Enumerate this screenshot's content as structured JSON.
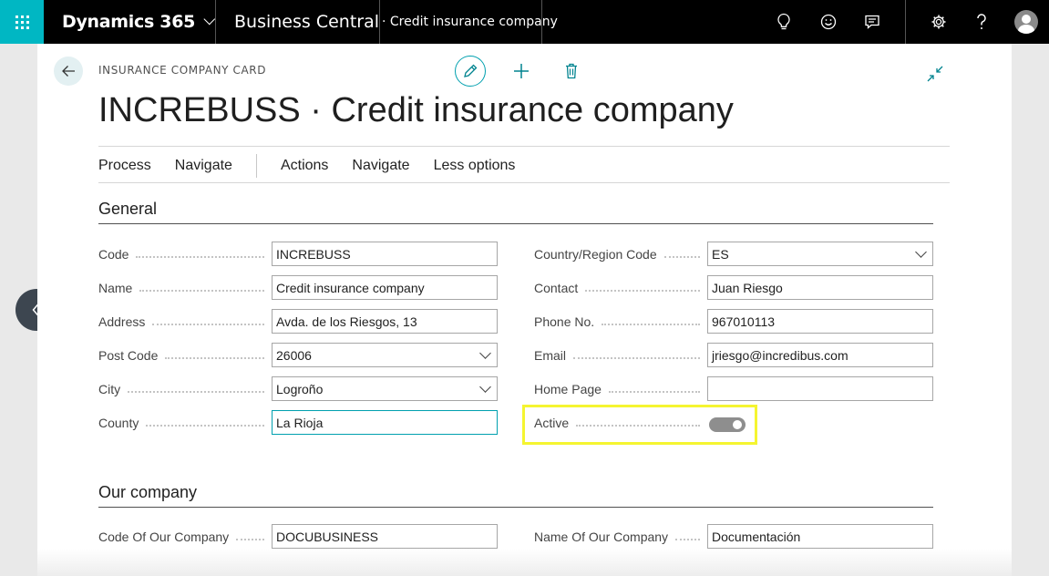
{
  "topbar": {
    "brand": "Dynamics 365",
    "product": "Business Central",
    "record": "· Credit insurance company",
    "icons": [
      "lightbulb-icon",
      "smiley-icon",
      "chat-icon",
      "gear-icon",
      "help-icon",
      "avatar"
    ]
  },
  "card": {
    "caption": "INSURANCE COMPANY CARD",
    "title": "INCREBUSS · Credit insurance company",
    "actions": [
      "Process",
      "Navigate",
      "Actions",
      "Navigate",
      "Less options"
    ]
  },
  "general": {
    "title": "General",
    "left": [
      {
        "label": "Code",
        "value": "INCREBUSS",
        "dropdown": false
      },
      {
        "label": "Name",
        "value": "Credit insurance company",
        "dropdown": false
      },
      {
        "label": "Address",
        "value": "Avda. de los Riesgos, 13",
        "dropdown": false
      },
      {
        "label": "Post Code",
        "value": "26006",
        "dropdown": true
      },
      {
        "label": "City",
        "value": "Logroño",
        "dropdown": true
      },
      {
        "label": "County",
        "value": "La Rioja",
        "dropdown": false
      }
    ],
    "right": [
      {
        "label": "Country/Region Code",
        "value": "ES",
        "dropdown": true
      },
      {
        "label": "Contact",
        "value": "Juan Riesgo",
        "dropdown": false
      },
      {
        "label": "Phone No.",
        "value": "967010113",
        "dropdown": false
      },
      {
        "label": "Email",
        "value": "jriesgo@incredibus.com",
        "dropdown": false
      },
      {
        "label": "Home Page",
        "value": "",
        "dropdown": false
      }
    ],
    "active": {
      "label": "Active",
      "on": true
    }
  },
  "our_company": {
    "title": "Our company",
    "left": {
      "label": "Code Of Our Company",
      "value": "DOCUBUSINESS"
    },
    "right": {
      "label": "Name Of Our Company",
      "value": "Documentación"
    }
  },
  "colors": {
    "accent": "#00b7c3",
    "highlight": "#f5f530",
    "toggle": "#8e8e8e"
  }
}
